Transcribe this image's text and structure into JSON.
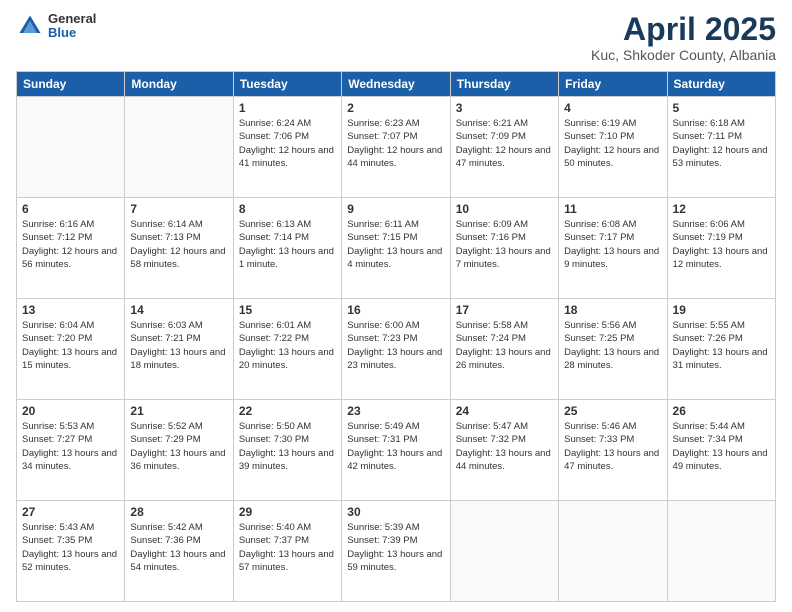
{
  "logo": {
    "general": "General",
    "blue": "Blue"
  },
  "title": {
    "month_year": "April 2025",
    "location": "Kuc, Shkoder County, Albania"
  },
  "headers": [
    "Sunday",
    "Monday",
    "Tuesday",
    "Wednesday",
    "Thursday",
    "Friday",
    "Saturday"
  ],
  "weeks": [
    [
      {
        "num": "",
        "info": ""
      },
      {
        "num": "",
        "info": ""
      },
      {
        "num": "1",
        "info": "Sunrise: 6:24 AM\nSunset: 7:06 PM\nDaylight: 12 hours and 41 minutes."
      },
      {
        "num": "2",
        "info": "Sunrise: 6:23 AM\nSunset: 7:07 PM\nDaylight: 12 hours and 44 minutes."
      },
      {
        "num": "3",
        "info": "Sunrise: 6:21 AM\nSunset: 7:09 PM\nDaylight: 12 hours and 47 minutes."
      },
      {
        "num": "4",
        "info": "Sunrise: 6:19 AM\nSunset: 7:10 PM\nDaylight: 12 hours and 50 minutes."
      },
      {
        "num": "5",
        "info": "Sunrise: 6:18 AM\nSunset: 7:11 PM\nDaylight: 12 hours and 53 minutes."
      }
    ],
    [
      {
        "num": "6",
        "info": "Sunrise: 6:16 AM\nSunset: 7:12 PM\nDaylight: 12 hours and 56 minutes."
      },
      {
        "num": "7",
        "info": "Sunrise: 6:14 AM\nSunset: 7:13 PM\nDaylight: 12 hours and 58 minutes."
      },
      {
        "num": "8",
        "info": "Sunrise: 6:13 AM\nSunset: 7:14 PM\nDaylight: 13 hours and 1 minute."
      },
      {
        "num": "9",
        "info": "Sunrise: 6:11 AM\nSunset: 7:15 PM\nDaylight: 13 hours and 4 minutes."
      },
      {
        "num": "10",
        "info": "Sunrise: 6:09 AM\nSunset: 7:16 PM\nDaylight: 13 hours and 7 minutes."
      },
      {
        "num": "11",
        "info": "Sunrise: 6:08 AM\nSunset: 7:17 PM\nDaylight: 13 hours and 9 minutes."
      },
      {
        "num": "12",
        "info": "Sunrise: 6:06 AM\nSunset: 7:19 PM\nDaylight: 13 hours and 12 minutes."
      }
    ],
    [
      {
        "num": "13",
        "info": "Sunrise: 6:04 AM\nSunset: 7:20 PM\nDaylight: 13 hours and 15 minutes."
      },
      {
        "num": "14",
        "info": "Sunrise: 6:03 AM\nSunset: 7:21 PM\nDaylight: 13 hours and 18 minutes."
      },
      {
        "num": "15",
        "info": "Sunrise: 6:01 AM\nSunset: 7:22 PM\nDaylight: 13 hours and 20 minutes."
      },
      {
        "num": "16",
        "info": "Sunrise: 6:00 AM\nSunset: 7:23 PM\nDaylight: 13 hours and 23 minutes."
      },
      {
        "num": "17",
        "info": "Sunrise: 5:58 AM\nSunset: 7:24 PM\nDaylight: 13 hours and 26 minutes."
      },
      {
        "num": "18",
        "info": "Sunrise: 5:56 AM\nSunset: 7:25 PM\nDaylight: 13 hours and 28 minutes."
      },
      {
        "num": "19",
        "info": "Sunrise: 5:55 AM\nSunset: 7:26 PM\nDaylight: 13 hours and 31 minutes."
      }
    ],
    [
      {
        "num": "20",
        "info": "Sunrise: 5:53 AM\nSunset: 7:27 PM\nDaylight: 13 hours and 34 minutes."
      },
      {
        "num": "21",
        "info": "Sunrise: 5:52 AM\nSunset: 7:29 PM\nDaylight: 13 hours and 36 minutes."
      },
      {
        "num": "22",
        "info": "Sunrise: 5:50 AM\nSunset: 7:30 PM\nDaylight: 13 hours and 39 minutes."
      },
      {
        "num": "23",
        "info": "Sunrise: 5:49 AM\nSunset: 7:31 PM\nDaylight: 13 hours and 42 minutes."
      },
      {
        "num": "24",
        "info": "Sunrise: 5:47 AM\nSunset: 7:32 PM\nDaylight: 13 hours and 44 minutes."
      },
      {
        "num": "25",
        "info": "Sunrise: 5:46 AM\nSunset: 7:33 PM\nDaylight: 13 hours and 47 minutes."
      },
      {
        "num": "26",
        "info": "Sunrise: 5:44 AM\nSunset: 7:34 PM\nDaylight: 13 hours and 49 minutes."
      }
    ],
    [
      {
        "num": "27",
        "info": "Sunrise: 5:43 AM\nSunset: 7:35 PM\nDaylight: 13 hours and 52 minutes."
      },
      {
        "num": "28",
        "info": "Sunrise: 5:42 AM\nSunset: 7:36 PM\nDaylight: 13 hours and 54 minutes."
      },
      {
        "num": "29",
        "info": "Sunrise: 5:40 AM\nSunset: 7:37 PM\nDaylight: 13 hours and 57 minutes."
      },
      {
        "num": "30",
        "info": "Sunrise: 5:39 AM\nSunset: 7:39 PM\nDaylight: 13 hours and 59 minutes."
      },
      {
        "num": "",
        "info": ""
      },
      {
        "num": "",
        "info": ""
      },
      {
        "num": "",
        "info": ""
      }
    ]
  ],
  "colors": {
    "header_bg": "#1a5fa8",
    "header_text": "#ffffff",
    "title_color": "#1a3a5c"
  }
}
